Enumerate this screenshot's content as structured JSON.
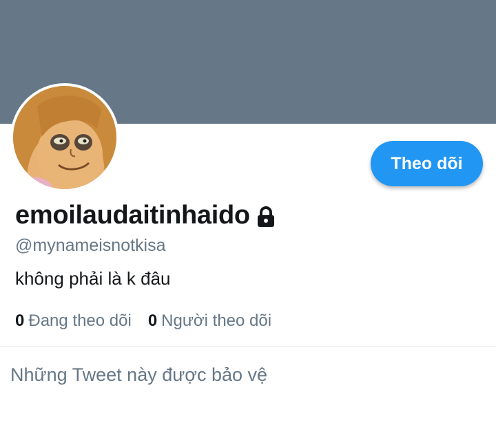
{
  "profile": {
    "display_name": "emoilaudaitinhaido",
    "handle": "@mynameisnotkisa",
    "bio": "không phải là k đâu",
    "protected": true
  },
  "actions": {
    "follow_label": "Theo dõi"
  },
  "stats": {
    "following_count": "0",
    "following_label": "Đang theo dõi",
    "followers_count": "0",
    "followers_label": "Người theo dõi"
  },
  "protected_message": "Những Tweet này được bảo vệ",
  "icons": {
    "lock": "lock-icon"
  },
  "colors": {
    "banner": "#667788",
    "accent": "#2196f3",
    "secondary_text": "#657786",
    "primary_text": "#14171a"
  }
}
